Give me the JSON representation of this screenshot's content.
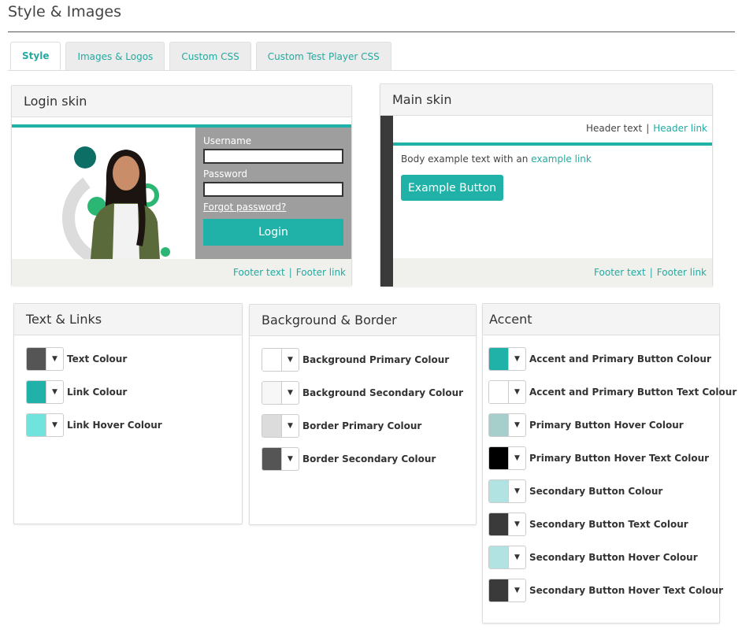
{
  "page": {
    "title": "Style & Images"
  },
  "tabs": [
    {
      "label": "Style",
      "active": true
    },
    {
      "label": "Images & Logos"
    },
    {
      "label": "Custom CSS"
    },
    {
      "label": "Custom Test Player CSS"
    }
  ],
  "login_skin": {
    "title": "Login skin",
    "username_label": "Username",
    "password_label": "Password",
    "forgot_link": "Forgot password?",
    "login_button": "Login",
    "footer_text": "Footer text",
    "footer_sep": "|",
    "footer_link": "Footer link"
  },
  "main_skin": {
    "title": "Main skin",
    "header_text": "Header text",
    "header_sep": "|",
    "header_link": "Header link",
    "body_text": "Body example text with an",
    "body_link": "example link",
    "example_button": "Example Button",
    "footer_text": "Footer text",
    "footer_sep": "|",
    "footer_link": "Footer link"
  },
  "text_links": {
    "title": "Text & Links",
    "rows": [
      {
        "label": "Text Colour",
        "color": "#555555"
      },
      {
        "label": "Link Colour",
        "color": "#20b2a8"
      },
      {
        "label": "Link Hover Colour",
        "color": "#6fe3dc"
      }
    ]
  },
  "background_border": {
    "title": "Background & Border",
    "rows": [
      {
        "label": "Background Primary Colour",
        "color": "#ffffff"
      },
      {
        "label": "Background Secondary Colour",
        "color": "#f7f7f7"
      },
      {
        "label": "Border Primary Colour",
        "color": "#dcdcdc"
      },
      {
        "label": "Border Secondary Colour",
        "color": "#555555"
      }
    ]
  },
  "accent": {
    "title": "Accent",
    "rows": [
      {
        "label": "Accent and Primary Button Colour",
        "color": "#20b2a8"
      },
      {
        "label": "Accent and Primary Button Text Colour",
        "color": "#ffffff"
      },
      {
        "label": "Primary Button Hover Colour",
        "color": "#a6cfcc"
      },
      {
        "label": "Primary Button Hover Text Colour",
        "color": "#000000"
      },
      {
        "label": "Secondary Button Colour",
        "color": "#b2e3e3"
      },
      {
        "label": "Secondary Button Text Colour",
        "color": "#3a3a3a"
      },
      {
        "label": "Secondary Button Hover Colour",
        "color": "#b2e3e3"
      },
      {
        "label": "Secondary Button Hover Text Colour",
        "color": "#3a3a3a"
      }
    ]
  },
  "colors": {
    "accent": "#20b2a8",
    "dark": "#3a3a3a",
    "login_form_bg": "#9e9e9e"
  },
  "icons": {
    "dropdown": "caret-down-icon"
  }
}
